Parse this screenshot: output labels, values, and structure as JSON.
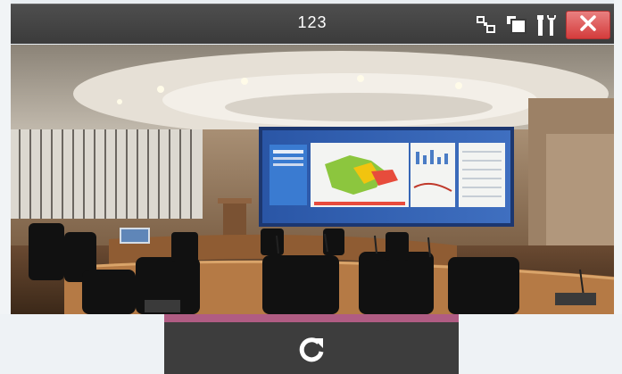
{
  "window": {
    "title": "123",
    "title_icons": [
      "split-view-icon",
      "fullscreen-icon",
      "settings-tools-icon"
    ],
    "close_icon": "close-icon",
    "close_color": "#d43c3c"
  },
  "viewer": {
    "content": "conference-room-camera-feed",
    "refresh_icon": "refresh-icon",
    "refresh_bar_color": "#b05c83"
  }
}
